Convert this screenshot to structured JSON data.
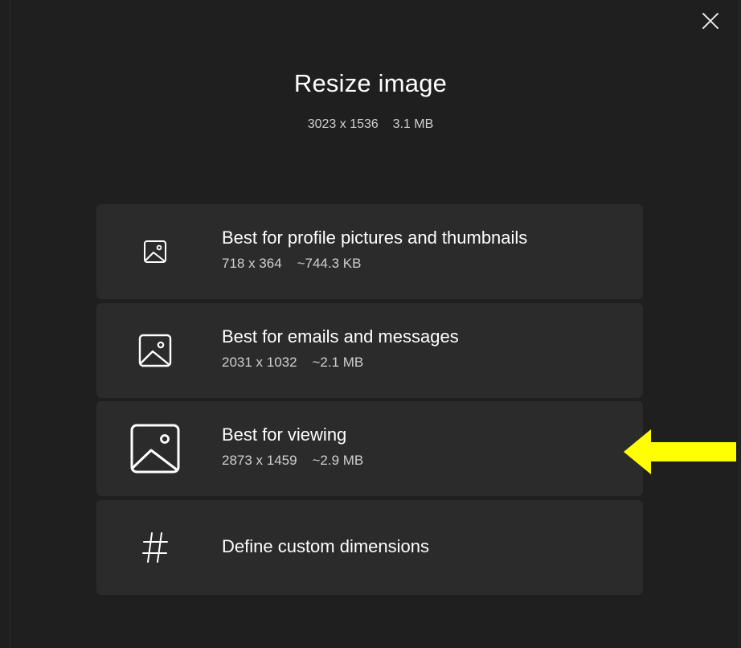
{
  "dialog": {
    "title": "Resize image",
    "subtitle": "3023 x 1536    3.1 MB",
    "close_icon": "close-icon"
  },
  "options": [
    {
      "label": "Best for profile pictures and thumbnails",
      "info": "718 x 364    ~744.3 KB",
      "icon": "image-small-icon"
    },
    {
      "label": "Best for emails and messages",
      "info": "2031 x 1032    ~2.1 MB",
      "icon": "image-medium-icon"
    },
    {
      "label": "Best for viewing",
      "info": "2873 x 1459    ~2.9 MB",
      "icon": "image-large-icon"
    },
    {
      "label": "Define custom dimensions",
      "icon": "hash-icon"
    }
  ],
  "annotation": {
    "arrow_icon": "pointer-arrow-icon",
    "arrow_color": "#ffff00",
    "points_to": "Best for viewing"
  },
  "colors": {
    "background": "#1f1f1f",
    "card": "#2b2b2b",
    "text": "#ffffff",
    "secondary_text": "#cfcfcf"
  }
}
